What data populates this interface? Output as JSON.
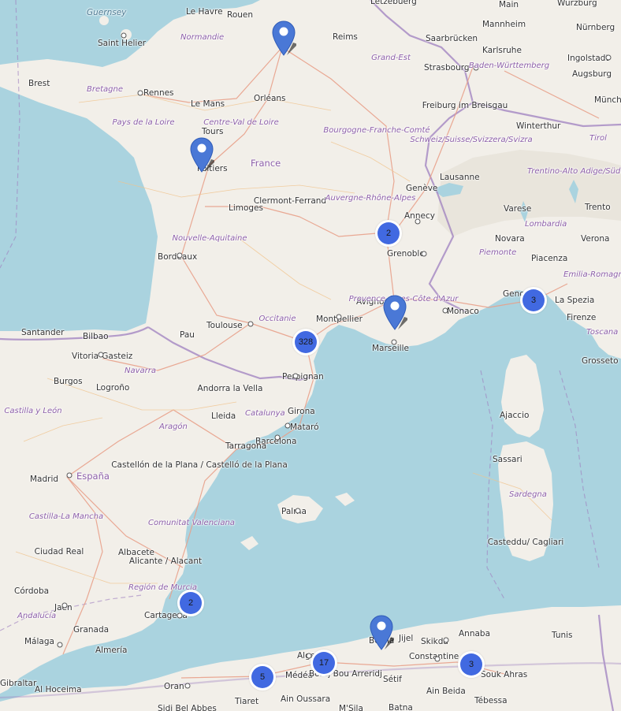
{
  "map": {
    "labels": {
      "countries": [
        "France",
        "España"
      ],
      "cities": [
        "Guernsey",
        "Saint Helier",
        "Le Havre",
        "Rouen",
        "Lëtzebuerg",
        "Main",
        "Würzburg",
        "Nürnberg",
        "Reims",
        "Saarbrücken",
        "Mannheim",
        "Karlsruhe",
        "Ingolstadt",
        "Brest",
        "Rennes",
        "Strasbourg",
        "Augsburg",
        "Münch",
        "Le Mans",
        "Orléans",
        "Freiburg im Breisgau",
        "Tours",
        "Winterthur",
        "Poitiers",
        "Lausanne",
        "Genève",
        "Annecy",
        "Limoges",
        "Clermont-Ferrand",
        "Varese",
        "Trento",
        "Grenoble",
        "Novara",
        "Verona",
        "Bordeaux",
        "Piacenza",
        "Avignon",
        "Monaco",
        "Genova",
        "La Spezia",
        "Firenze",
        "Toulouse",
        "Montpellier",
        "Santander",
        "Bilbao",
        "Pau",
        "Marseille",
        "Vitoria-Gasteiz",
        "Grosseto",
        "Burgos",
        "Logroño",
        "Andorra la Vella",
        "Perpignan",
        "Girona",
        "Ajaccio",
        "Lleida",
        "Mataró",
        "Barcelona",
        "Tarragona",
        "Sassari",
        "Castellón de la Plana / Castelló de la Plana",
        "Madrid",
        "Palma",
        "Casteddu/ Cagliari",
        "Ciudad Real",
        "Albacete",
        "Alicante / Alacant",
        "Córdoba",
        "Jaén",
        "Cartagena",
        "Granada",
        "Málaga",
        "Almería",
        "Bejaïa",
        "Jijel",
        "Skikda",
        "Annaba",
        "Tunis",
        "Alger",
        "Constantine",
        "Médéa",
        "Bordj Bou Arreridj",
        "Sétif",
        "Souk Ahras",
        "Oran",
        "Ain Beida",
        "Tiaret",
        "Ain Oussara",
        "Tébessa",
        "Sidi Bel Abbes",
        "M'Sila",
        "Batna",
        "Al Hoceima",
        "Gibraltar"
      ],
      "regions": [
        "Normandie",
        "Bretagne",
        "Pays de la Loire",
        "Centre-Val de Loire",
        "Grand-Est",
        "Bourgogne-Franche-Comté",
        "Baden-Württemberg",
        "Schweiz/Suisse/Svizzera/Svizra",
        "Tirol",
        "Trentino-Alto Adige/Südtirol",
        "Nouvelle-Aquitaine",
        "Auvergne-Rhône-Alpes",
        "Lombardia",
        "Piemonte",
        "Emilia-Romagna",
        "Provence-Alpes-Côte d'Azur",
        "Occitanie",
        "Toscana",
        "Navarra",
        "Aragón",
        "Castilla y León",
        "Catalunya",
        "Comunitat Valenciana",
        "Castilla-La Mancha",
        "Región de Murcia",
        "Andalucía",
        "Sardegna"
      ]
    },
    "clusters": [
      {
        "id": "cluster-grenoble",
        "count": "2"
      },
      {
        "id": "cluster-genova",
        "count": "3"
      },
      {
        "id": "cluster-montpellier",
        "count": "328"
      },
      {
        "id": "cluster-cartagena",
        "count": "2"
      },
      {
        "id": "cluster-alger",
        "count": "17"
      },
      {
        "id": "cluster-medea",
        "count": "5"
      },
      {
        "id": "cluster-souk-ahras",
        "count": "3"
      }
    ],
    "markers": [
      {
        "id": "marker-paris"
      },
      {
        "id": "marker-poitiers"
      },
      {
        "id": "marker-marseille"
      },
      {
        "id": "marker-bejaia"
      }
    ],
    "colors": {
      "water": "#aad3df",
      "land": "#f2efe9",
      "cluster_fill": "#4169e1",
      "marker_fill": "#4a78d6",
      "border": "#9e7fbf"
    }
  }
}
